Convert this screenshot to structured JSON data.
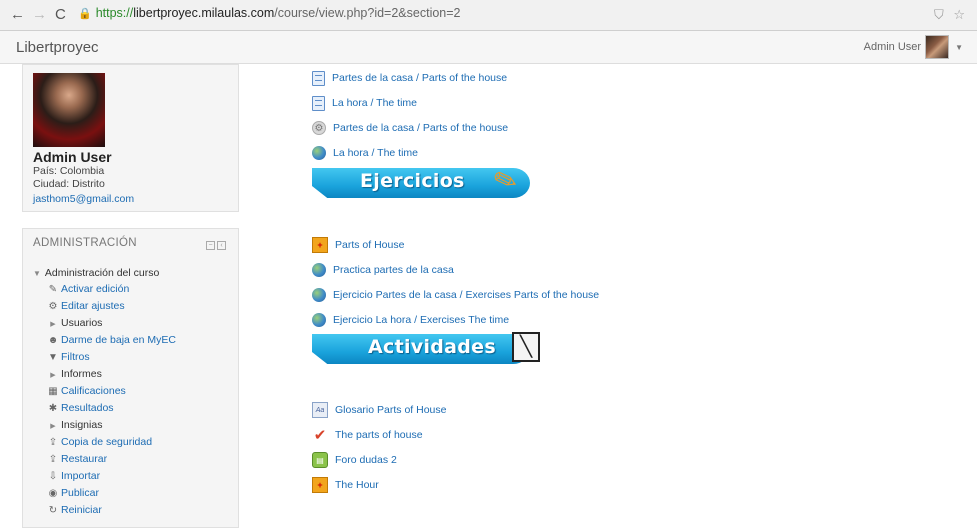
{
  "browser": {
    "url_https": "https://",
    "url_domain": "libertproyec.milaulas.com",
    "url_path": "/course/view.php?id=2&section=2"
  },
  "navbar": {
    "brand": "Libertproyec",
    "user_name": "Admin User"
  },
  "profile": {
    "name": "Admin User",
    "country": "País: Colombia",
    "city": "Ciudad: Distrito",
    "email": "jasthom5@gmail.com"
  },
  "admin": {
    "title": "ADMINISTRACIÓN",
    "root": "Administración del curso",
    "items": [
      {
        "label": "Activar edición",
        "type": "link",
        "icon": "pencil-icon"
      },
      {
        "label": "Editar ajustes",
        "type": "link",
        "icon": "gear-icon"
      },
      {
        "label": "Usuarios",
        "type": "folder",
        "icon": "triangle-right-icon"
      },
      {
        "label": "Darme de baja en MyEC",
        "type": "link",
        "icon": "user-icon"
      },
      {
        "label": "Filtros",
        "type": "link",
        "icon": "filter-icon"
      },
      {
        "label": "Informes",
        "type": "folder",
        "icon": "triangle-right-icon"
      },
      {
        "label": "Calificaciones",
        "type": "link",
        "icon": "table-icon"
      },
      {
        "label": "Resultados",
        "type": "link",
        "icon": "outcomes-icon"
      },
      {
        "label": "Insignias",
        "type": "folder",
        "icon": "triangle-right-icon"
      },
      {
        "label": "Copia de seguridad",
        "type": "link",
        "icon": "backup-icon"
      },
      {
        "label": "Restaurar",
        "type": "link",
        "icon": "restore-icon"
      },
      {
        "label": "Importar",
        "type": "link",
        "icon": "import-icon"
      },
      {
        "label": "Publicar",
        "type": "link",
        "icon": "publish-icon"
      },
      {
        "label": "Reiniciar",
        "type": "link",
        "icon": "reset-icon"
      }
    ]
  },
  "content": {
    "top_resources": [
      {
        "label": "Partes de la casa / Parts of the house",
        "icon": "page-icon"
      },
      {
        "label": "La hora / The time",
        "icon": "page-icon"
      },
      {
        "label": "Partes de la casa / Parts of the house",
        "icon": "file-icon"
      },
      {
        "label": "La hora / The time",
        "icon": "url-globe-icon"
      }
    ],
    "banner1": "Ejercicios",
    "exercises": [
      {
        "label": "Parts of House",
        "icon": "scorm-icon"
      },
      {
        "label": "Practica partes de la casa",
        "icon": "url-globe-icon"
      },
      {
        "label": "Ejercicio Partes de la casa / Exercises Parts of the house",
        "icon": "url-globe-icon"
      },
      {
        "label": "Ejercicio La hora / Exercises The time",
        "icon": "url-globe-icon"
      }
    ],
    "banner2": "Actividades",
    "activities": [
      {
        "label": "Glosario Parts of House",
        "icon": "glossary-icon"
      },
      {
        "label": "The parts of house",
        "icon": "checkmark-icon"
      },
      {
        "label": "Foro dudas 2",
        "icon": "forum-icon"
      },
      {
        "label": "The Hour",
        "icon": "scorm-icon"
      }
    ]
  }
}
